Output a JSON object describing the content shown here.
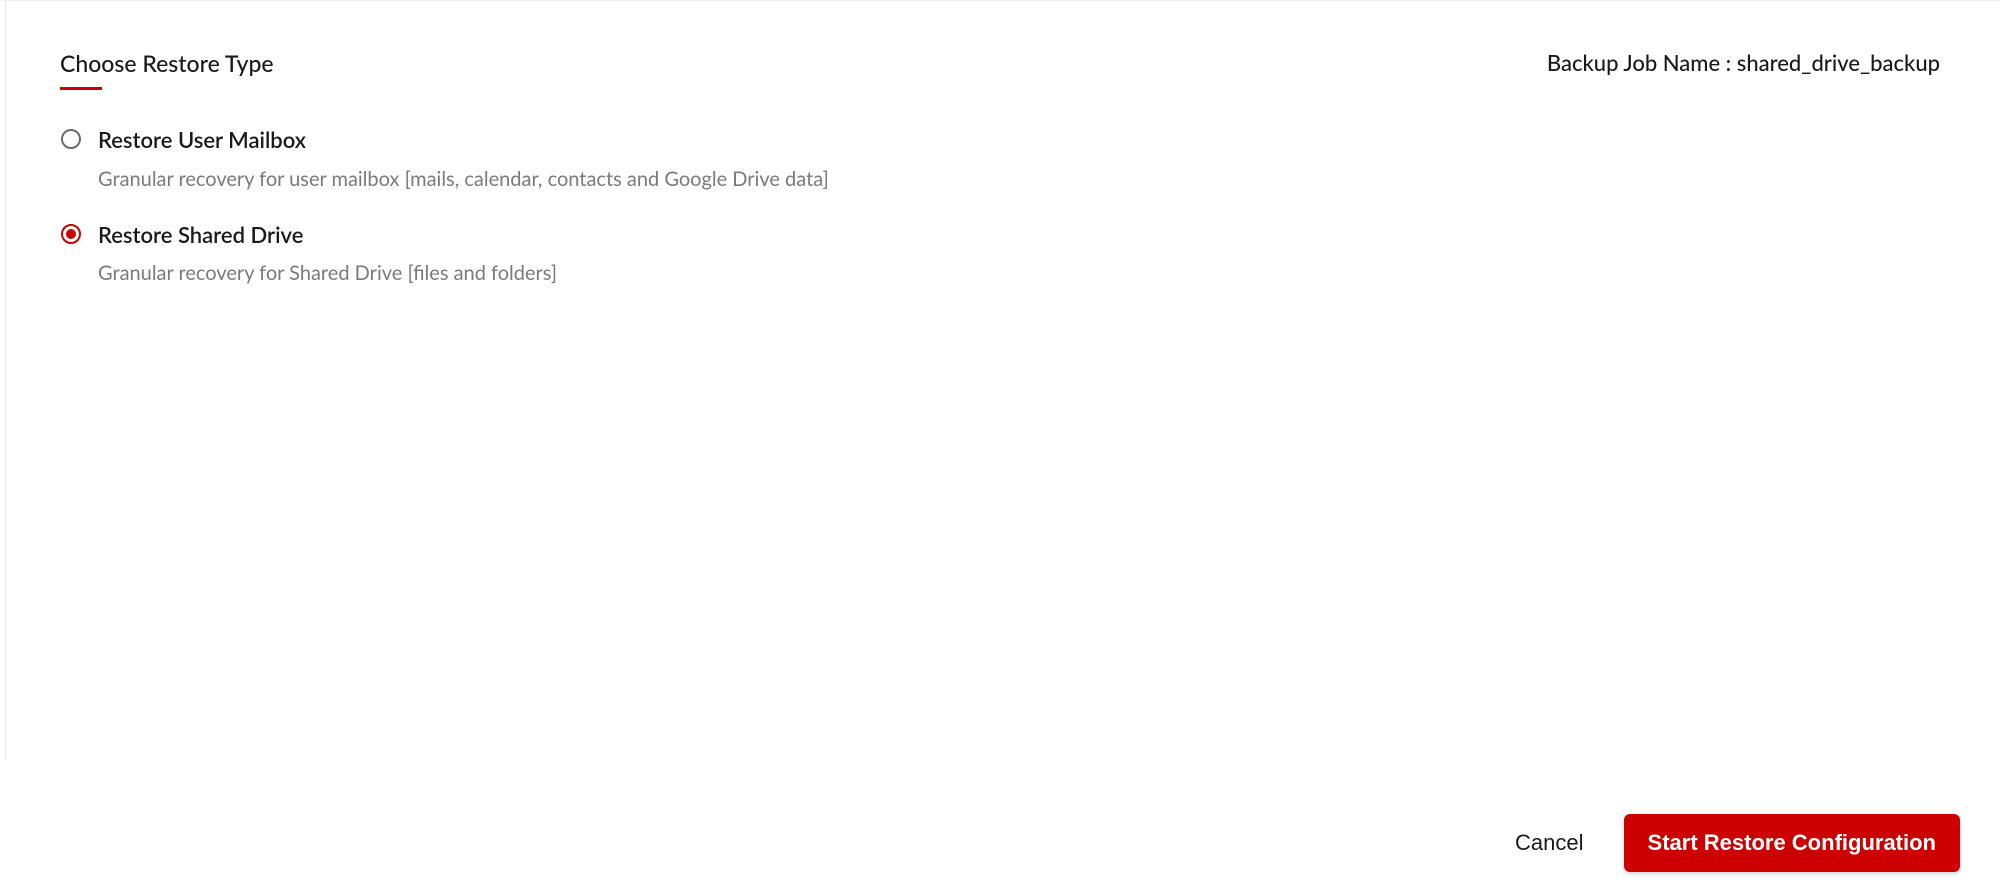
{
  "header": {
    "section_title": "Choose Restore Type",
    "backup_job_label": "Backup Job Name : shared_drive_backup"
  },
  "options": {
    "restore_user_mailbox": {
      "label": "Restore User Mailbox",
      "description": "Granular recovery for user mailbox [mails, calendar, contacts and Google Drive data]",
      "selected": false
    },
    "restore_shared_drive": {
      "label": "Restore Shared Drive",
      "description": "Granular recovery for Shared Drive [files and folders]",
      "selected": true
    }
  },
  "footer": {
    "cancel_label": "Cancel",
    "start_label": "Start Restore Configuration"
  },
  "colors": {
    "accent": "#cc0000",
    "text_primary": "#1a1a1a",
    "text_muted": "#7a7a7a"
  }
}
